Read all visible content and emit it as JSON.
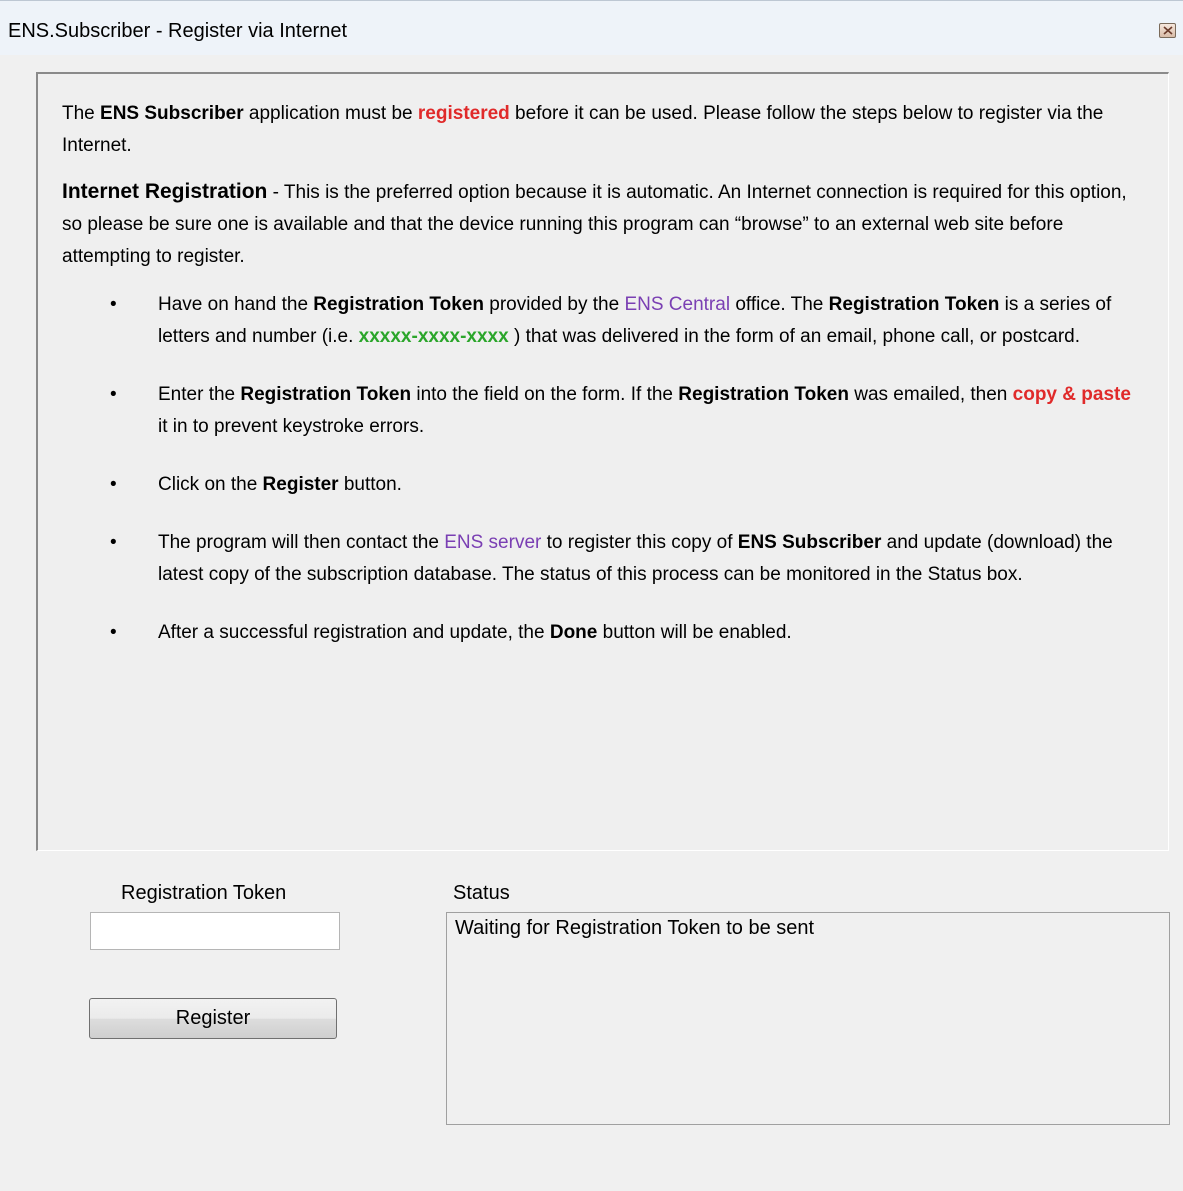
{
  "window": {
    "title": "ENS.Subscriber - Register via Internet"
  },
  "intro": {
    "t1": "The ",
    "b1": "ENS Subscriber",
    "t2": " application must be ",
    "red1": "registered",
    "t3": " before it can be used.  Please follow the steps below to register via the Internet."
  },
  "internet": {
    "heading": "Internet Registration",
    "text": " - This is the preferred option because it is automatic.  An Internet connection is required for this option, so please be sure one is available and that the device running this program can “browse” to an external web site before attempting to register."
  },
  "bullet": "•",
  "step1": {
    "t1": "Have on hand the ",
    "b1": "Registration Token",
    "t2": " provided by the ",
    "p1": "ENS Central",
    "t3": " office.  The ",
    "b2": "Registration Token",
    "t4": " is a series of letters and number (i.e. ",
    "g1": "xxxxx-xxxx-xxxx",
    "t5": " ) that was delivered in the form of an email, phone call, or postcard."
  },
  "step2": {
    "t1": "Enter the ",
    "b1": "Registration Token",
    "t2": " into the field on the form.  If the ",
    "b2": "Registration Token",
    "t3": " was emailed, then ",
    "r1": "copy & paste",
    "t4": " it in to prevent keystroke errors."
  },
  "step3": {
    "t1": "Click on the ",
    "b1": "Register",
    "t2": " button."
  },
  "step4": {
    "t1": "The program will then contact the ",
    "p1": "ENS server",
    "t2": " to register this copy of ",
    "b1": "ENS Subscriber",
    "t3": " and update (download) the latest copy of the subscription database. The status of this process can be monitored in the Status box."
  },
  "step5": {
    "t1": "After a successful registration and update, the ",
    "b1": "Done",
    "t2": " button will be enabled."
  },
  "form": {
    "token_label": "Registration Token",
    "token_value": "",
    "register_label": "Register",
    "status_label": "Status",
    "status_text": "Waiting for Registration Token to be sent"
  },
  "colors": {
    "emphasis_red": "#e02a2a",
    "link_purple": "#7a3fb3",
    "example_green": "#2aa52a"
  },
  "icons": {
    "close": "close-icon"
  }
}
